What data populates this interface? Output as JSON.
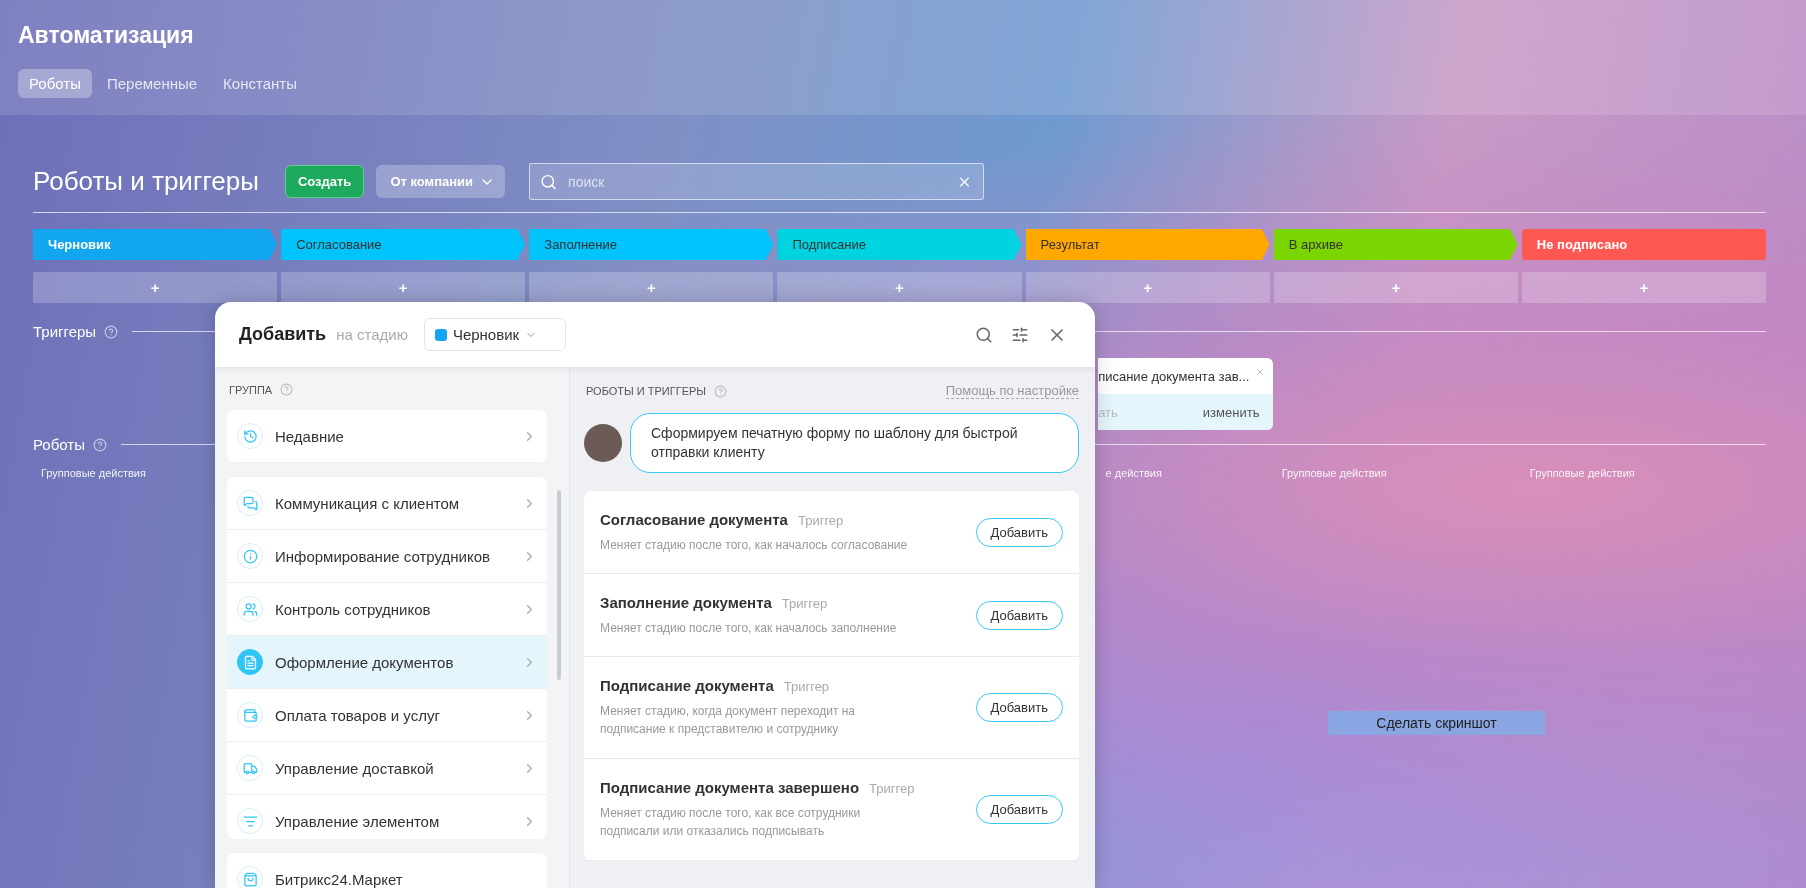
{
  "header": {
    "title": "Автоматизация",
    "tabs": [
      {
        "label": "Роботы",
        "selected": true
      },
      {
        "label": "Переменные",
        "selected": false
      },
      {
        "label": "Константы",
        "selected": false
      }
    ]
  },
  "toolbar": {
    "title": "Роботы и триггеры",
    "create_button": "Создать",
    "filter_button": "От компании",
    "search": {
      "placeholder": "поиск"
    }
  },
  "stages": [
    {
      "name": "Черновик",
      "color": "#12a6f0",
      "light_label": true,
      "add": "+",
      "group_action": {
        "text": "Групповые действия"
      }
    },
    {
      "name": "Согласование",
      "color": "#00c4fb",
      "light_label": false,
      "add": "+"
    },
    {
      "name": "Заполнение",
      "color": "#00c4fb",
      "light_label": false,
      "add": "+"
    },
    {
      "name": "Подписание",
      "color": "#00d3e0",
      "light_label": false,
      "add": "+"
    },
    {
      "name": "Результат",
      "color": "#ffa800",
      "light_label": false,
      "add": "+",
      "trigger": {
        "title": "писание документа зав...",
        "action_left": "ать",
        "action_right": "изменить",
        "covered": true
      },
      "group_action": {
        "text": "е действия",
        "covered": true
      }
    },
    {
      "name": "В архиве",
      "color": "#7bd500",
      "light_label": false,
      "add": "+",
      "group_action": {
        "text": "Групповые действия"
      }
    },
    {
      "name": "Не подписано",
      "color": "#ff5752",
      "light_label": true,
      "add": "+",
      "group_action": {
        "text": "Групповые действия"
      }
    }
  ],
  "triggers_section": {
    "title": "Триггеры"
  },
  "robots_section": {
    "title": "Роботы"
  },
  "screenshot_button": "Сделать скриншот",
  "modal": {
    "title": "Добавить",
    "stage_label": "на стадию",
    "stage": {
      "name": "Черновик",
      "color": "#12a6f0"
    },
    "group_title": "ГРУППА",
    "recent": "Недавние",
    "groups": [
      {
        "label": "Коммуникация с клиентом",
        "selected": false
      },
      {
        "label": "Информирование сотрудников",
        "selected": false
      },
      {
        "label": "Контроль сотрудников",
        "selected": false
      },
      {
        "label": "Оформление документов",
        "selected": true
      },
      {
        "label": "Оплата товаров и услуг",
        "selected": false
      },
      {
        "label": "Управление доставкой",
        "selected": false
      },
      {
        "label": "Управление элементом",
        "selected": false
      }
    ],
    "market": "Битрикс24.Маркет",
    "list_title": "РОБОТЫ И ТРИГГЕРЫ",
    "help_link": "Помощь по настройке",
    "tip": "Сформируем печатную форму по шаблону для быстрой отправки клиенту",
    "items": [
      {
        "title": "Согласование документа",
        "tag": "Триггер",
        "description": "Меняет стадию после того, как началось согласование",
        "button": "Добавить"
      },
      {
        "title": "Заполнение документа",
        "tag": "Триггер",
        "description": "Меняет стадию после того, как началось заполнение",
        "button": "Добавить"
      },
      {
        "title": "Подписание документа",
        "tag": "Триггер",
        "description": "Меняет стадию, когда документ переходит на подписание к представителю и сотруднику",
        "button": "Добавить"
      },
      {
        "title": "Подписание документа завершено",
        "tag": "Триггер",
        "description": "Меняет стадию после того, как все сотрудники подписали или отказались подписывать",
        "button": "Добавить"
      }
    ]
  }
}
